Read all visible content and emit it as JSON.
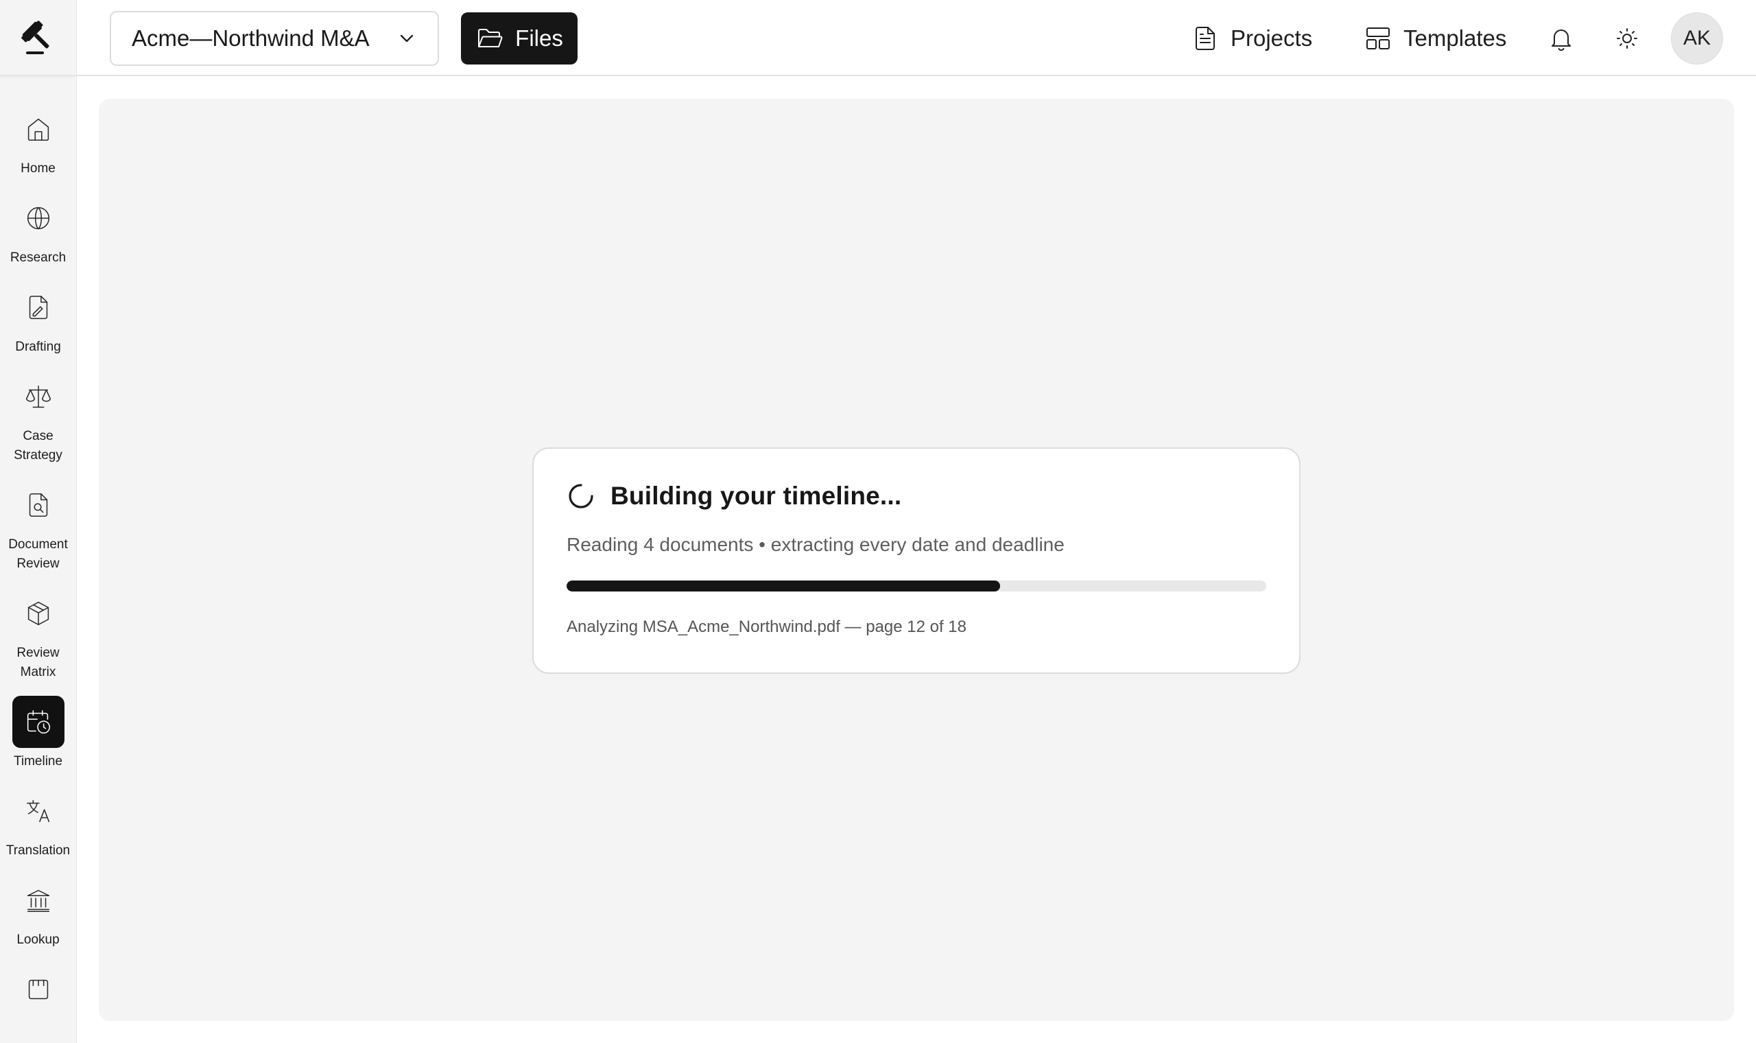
{
  "header": {
    "project_name": "Acme—Northwind M&A",
    "files_label": "Files",
    "projects_label": "Projects",
    "templates_label": "Templates",
    "avatar_initials": "AK"
  },
  "sidebar": {
    "items": [
      {
        "label": "Home",
        "icon": "home-icon"
      },
      {
        "label": "Research",
        "icon": "globe-icon"
      },
      {
        "label": "Drafting",
        "icon": "document-pen-icon"
      },
      {
        "label": "Case Strategy",
        "icon": "scales-icon"
      },
      {
        "label": "Document Review",
        "icon": "document-search-icon"
      },
      {
        "label": "Review Matrix",
        "icon": "cube-icon"
      },
      {
        "label": "Timeline",
        "icon": "calendar-clock-icon",
        "active": true
      },
      {
        "label": "Translation",
        "icon": "translate-icon"
      },
      {
        "label": "Lookup",
        "icon": "bank-icon"
      }
    ]
  },
  "loading_card": {
    "title": "Building your timeline...",
    "subtitle": "Reading 4 documents • extracting every date and deadline",
    "progress_percent": 62,
    "status": "Analyzing MSA_Acme_Northwind.pdf — page 12 of 18"
  },
  "colors": {
    "accent": "#111111",
    "main_bg": "#f4f4f4",
    "progress_track": "#e8e8e8"
  }
}
